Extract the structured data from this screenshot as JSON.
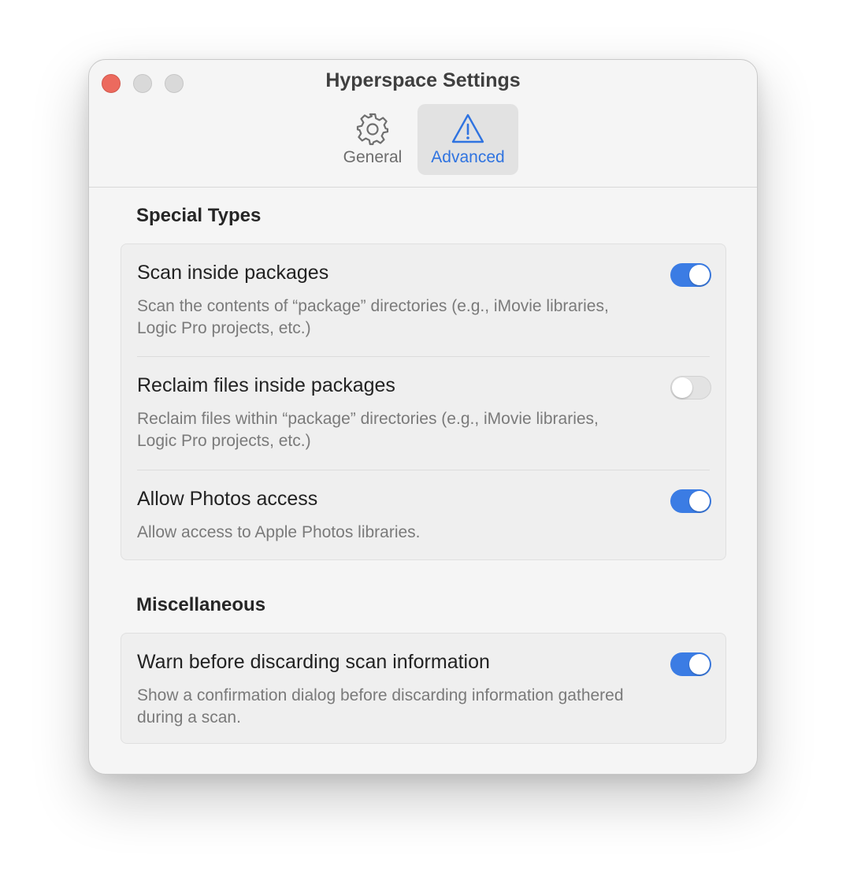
{
  "window": {
    "title": "Hyperspace Settings"
  },
  "tabs": [
    {
      "label": "General",
      "icon": "gear-icon",
      "selected": false
    },
    {
      "label": "Advanced",
      "icon": "warning-triangle-icon",
      "selected": true
    }
  ],
  "sections": {
    "special": {
      "title": "Special Types",
      "rows": [
        {
          "title": "Scan inside packages",
          "description": "Scan the contents of “package” directories (e.g., iMovie libraries, Logic Pro projects, etc.)",
          "enabled": true
        },
        {
          "title": "Reclaim files inside packages",
          "description": "Reclaim files within “package” directories (e.g., iMovie libraries, Logic Pro projects, etc.)",
          "enabled": false
        },
        {
          "title": "Allow Photos access",
          "description": "Allow access to Apple Photos libraries.",
          "enabled": true
        }
      ]
    },
    "misc": {
      "title": "Miscellaneous",
      "rows": [
        {
          "title": "Warn before discarding scan information",
          "description": "Show a confirmation dialog before discarding information gathered during a scan.",
          "enabled": true
        }
      ]
    }
  },
  "colors": {
    "accent": "#3b7ce4",
    "close": "#ec6a5e",
    "window_bg": "#f5f5f5"
  }
}
